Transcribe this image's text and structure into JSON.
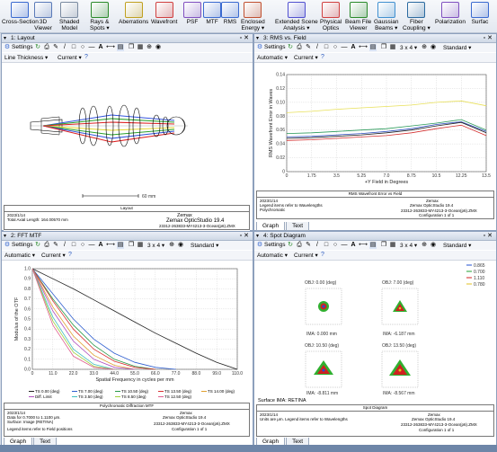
{
  "ribbon": {
    "buttons": [
      {
        "label1": "Cross-Section",
        "label2": "",
        "icon": "cross-section-icon"
      },
      {
        "label1": "3D",
        "label2": "Viewer",
        "icon": "3d-viewer-icon"
      },
      {
        "label1": "Shaded",
        "label2": "Model",
        "icon": "shaded-model-icon"
      },
      {
        "label1": "Rays &",
        "label2": "Spots ▾",
        "icon": "rays-spots-icon"
      },
      {
        "label1": "Aberrations",
        "label2": "",
        "icon": "aberrations-icon"
      },
      {
        "label1": "Wavefront",
        "label2": "",
        "icon": "wavefront-icon"
      },
      {
        "label1": "PSF",
        "label2": "",
        "icon": "psf-icon"
      },
      {
        "label1": "MTF",
        "label2": "",
        "icon": "mtf-icon"
      },
      {
        "label1": "RMS",
        "label2": "",
        "icon": "rms-icon"
      },
      {
        "label1": "Enclosed",
        "label2": "Energy ▾",
        "icon": "enclosed-energy-icon"
      },
      {
        "label1": "Extended Scene",
        "label2": "Analysis ▾",
        "icon": "extended-scene-icon"
      },
      {
        "label1": "Physical",
        "label2": "Optics",
        "icon": "physical-optics-icon"
      },
      {
        "label1": "Beam File",
        "label2": "Viewer",
        "icon": "beam-file-icon"
      },
      {
        "label1": "Gaussian",
        "label2": "Beams ▾",
        "icon": "gaussian-beams-icon"
      },
      {
        "label1": "Fiber",
        "label2": "Coupling ▾",
        "icon": "fiber-coupling-icon"
      },
      {
        "label1": "Polarization",
        "label2": "",
        "icon": "polarization-icon"
      },
      {
        "label1": "Surfac",
        "label2": "",
        "icon": "surface-icon"
      }
    ]
  },
  "windows": {
    "layout": {
      "title": "1: Layout",
      "settings": "Settings",
      "line_thickness": "Line Thickness ▾",
      "current": "Current ▾",
      "scale_label": "60 mm",
      "foot_title": "Layout",
      "foot_date": "2023/1/14",
      "foot_total": "Total Axial Length: 164.00570 mm",
      "foot_brand": "Zemax",
      "foot_product": "Zemax OpticStudio 19.4",
      "foot_file": "23312-263833-MY4213-3-Ocean(p6).ZMX",
      "foot_config": "Configuration 1 of 1",
      "tabs": []
    },
    "rms": {
      "title": "3: RMS vs. Field",
      "settings": "Settings",
      "grid": "3 x 4 ▾",
      "standard": "Standard ▾",
      "automatic": "Automatic ▾",
      "current": "Current ▾",
      "ylabel": "RMS Wavefront Error in Waves",
      "xlabel": "+Y Field in Degrees",
      "xticks": [
        "0",
        "1.75",
        "3.5",
        "5.25",
        "7.0",
        "8.75",
        "10.5",
        "12.25",
        "13.5"
      ],
      "yticks": [
        "0",
        "0.02",
        "0.04",
        "0.06",
        "0.08",
        "0.10",
        "0.12",
        "0.14"
      ],
      "foot_title": "RMS Wavefront Error vs Field",
      "foot_date": "2023/1/14",
      "foot_legend": "Legend items refer to Wavelengths",
      "foot_poly": "Polychromatic",
      "foot_brand": "Zemax",
      "foot_product": "Zemax OpticStudio 19.4",
      "foot_file": "23312-263833-MY4213-3-Ocean(p6).ZMX",
      "foot_config": "Configuration 1 of 1",
      "tabs": [
        "Graph",
        "Text"
      ]
    },
    "mtf": {
      "title": "2: FFT MTF",
      "settings": "Settings",
      "grid": "3 x 4 ▾",
      "standard": "Standard ▾",
      "automatic": "Automatic ▾",
      "current": "Current ▾",
      "ylabel": "Modulus of the OTF",
      "xlabel": "Spatial Frequency in cycles per mm",
      "xticks": [
        "0",
        "11.0",
        "22.0",
        "33.0",
        "44.0",
        "55.0",
        "66.0",
        "77.0",
        "88.0",
        "99.0",
        "110.0"
      ],
      "yticks": [
        "0.0",
        "0.1",
        "0.2",
        "0.3",
        "0.4",
        "0.5",
        "0.6",
        "0.7",
        "0.8",
        "0.9",
        "1.0"
      ],
      "legend": [
        "TS 0.00 (deg)",
        "TS 7.00 (deg)",
        "TS 10.50 (deg)",
        "TS 13.50 (deg)",
        "TS 14.00 (deg)",
        "Diff. Limit",
        "TS 3.50 (deg)",
        "TS 8.50 (deg)",
        "TS 12.50 (deg)"
      ],
      "foot_title": "Polychromatic Diffraction MTF",
      "foot_date": "2023/1/14",
      "foot_data": "Data for 0.7000 to 1.1100 μm.",
      "foot_surface": "Surface: Image (RETINA)",
      "foot_legend": "Legend items refer to Field positions",
      "foot_brand": "Zemax",
      "foot_product": "Zemax OpticStudio 19.4",
      "foot_file": "23312-263833-MY4213-3-Ocean(p6).ZMX",
      "foot_config": "Configuration 1 of 1",
      "tabs": [
        "Graph",
        "Text"
      ]
    },
    "spot": {
      "title": "4: Spot Diagram",
      "settings": "Settings",
      "grid": "3 x 4 ▾",
      "standard": "Standard ▾",
      "automatic": "Automatic ▾",
      "current": "Current ▾",
      "wavelengths": [
        "0.865",
        "0.700",
        "1.110",
        "0.780"
      ],
      "fields": [
        {
          "obj": "OBJ: 0.00 (deg)",
          "ima": "IMA: 0.000 mm"
        },
        {
          "obj": "OBJ: 7.00 (deg)",
          "ima": "IMA: -6.187 mm"
        },
        {
          "obj": "OBJ: 10.50 (deg)",
          "ima": "IMA: -8.811 mm"
        },
        {
          "obj": "OBJ: 13.50 (deg)",
          "ima": "IMA: -8.567 mm"
        }
      ],
      "surface": "Surface IMA: RETINA",
      "foot_title": "Spot Diagram",
      "foot_date": "2023/1/14",
      "foot_units": "Units are μm.  Legend items refer to Wavelengths",
      "foot_brand": "Zemax",
      "foot_product": "Zemax OpticStudio 19.4",
      "foot_file": "23312-263833-MY4213-3-Ocean(p6).ZMX",
      "foot_config": "Configuration 1 of 1",
      "tabs": [
        "Graph",
        "Text"
      ]
    }
  },
  "chart_data": [
    {
      "type": "line",
      "title": "",
      "xlabel": "+Y Field in Degrees",
      "ylabel": "RMS Wavefront Error in Waves",
      "xlim": [
        0,
        14
      ],
      "ylim": [
        0,
        0.14
      ],
      "x": [
        0,
        1.75,
        3.5,
        5.25,
        7.0,
        8.75,
        10.5,
        12.25,
        14.0
      ],
      "series": [
        {
          "color": "#e8e05a",
          "values": [
            0.085,
            0.087,
            0.09,
            0.092,
            0.094,
            0.096,
            0.1,
            0.102,
            0.095
          ]
        },
        {
          "color": "#2a9a5a",
          "values": [
            0.055,
            0.056,
            0.058,
            0.06,
            0.062,
            0.066,
            0.07,
            0.075,
            0.06
          ]
        },
        {
          "color": "#3050c0",
          "values": [
            0.05,
            0.051,
            0.053,
            0.055,
            0.058,
            0.062,
            0.068,
            0.072,
            0.058
          ]
        },
        {
          "color": "#d43030",
          "values": [
            0.045,
            0.046,
            0.048,
            0.05,
            0.052,
            0.056,
            0.062,
            0.067,
            0.052
          ]
        },
        {
          "color": "#222222",
          "values": [
            0.048,
            0.049,
            0.051,
            0.053,
            0.056,
            0.06,
            0.066,
            0.071,
            0.056
          ]
        }
      ]
    },
    {
      "type": "line",
      "title": "",
      "xlabel": "Spatial Frequency in cycles per mm",
      "ylabel": "Modulus of the OTF",
      "xlim": [
        0,
        110
      ],
      "ylim": [
        0,
        1
      ],
      "series": [
        {
          "color": "#222222",
          "x": [
            0,
            11,
            22,
            33,
            44,
            55,
            66,
            77,
            88,
            99,
            110
          ],
          "values": [
            1,
            0.9,
            0.8,
            0.69,
            0.58,
            0.47,
            0.36,
            0.26,
            0.16,
            0.07,
            0
          ]
        },
        {
          "color": "#2f5fd0",
          "x": [
            0,
            11,
            22,
            33,
            44,
            55,
            66,
            77
          ],
          "values": [
            1,
            0.75,
            0.5,
            0.3,
            0.16,
            0.07,
            0.02,
            0
          ]
        },
        {
          "color": "#2a9a4a",
          "x": [
            0,
            11,
            22,
            33,
            44,
            55,
            66
          ],
          "values": [
            1,
            0.7,
            0.44,
            0.24,
            0.1,
            0.03,
            0
          ]
        },
        {
          "color": "#d83030",
          "x": [
            0,
            11,
            22,
            33,
            44,
            55,
            66
          ],
          "values": [
            1,
            0.68,
            0.4,
            0.2,
            0.08,
            0.02,
            0
          ]
        },
        {
          "color": "#e0a030",
          "x": [
            0,
            11,
            22,
            33,
            44,
            55
          ],
          "values": [
            1,
            0.62,
            0.33,
            0.14,
            0.04,
            0
          ]
        },
        {
          "color": "#b050c0",
          "x": [
            0,
            11,
            22,
            33,
            44,
            55
          ],
          "values": [
            1,
            0.58,
            0.28,
            0.1,
            0.02,
            0
          ]
        },
        {
          "color": "#40c0c0",
          "x": [
            0,
            11,
            22,
            33,
            44
          ],
          "values": [
            1,
            0.52,
            0.2,
            0.05,
            0
          ]
        },
        {
          "color": "#a0d040",
          "x": [
            0,
            11,
            22,
            33,
            44
          ],
          "values": [
            1,
            0.48,
            0.17,
            0.03,
            0
          ]
        },
        {
          "color": "#e06090",
          "x": [
            0,
            11,
            22,
            33,
            44
          ],
          "values": [
            1,
            0.44,
            0.13,
            0.02,
            0
          ]
        }
      ]
    }
  ]
}
